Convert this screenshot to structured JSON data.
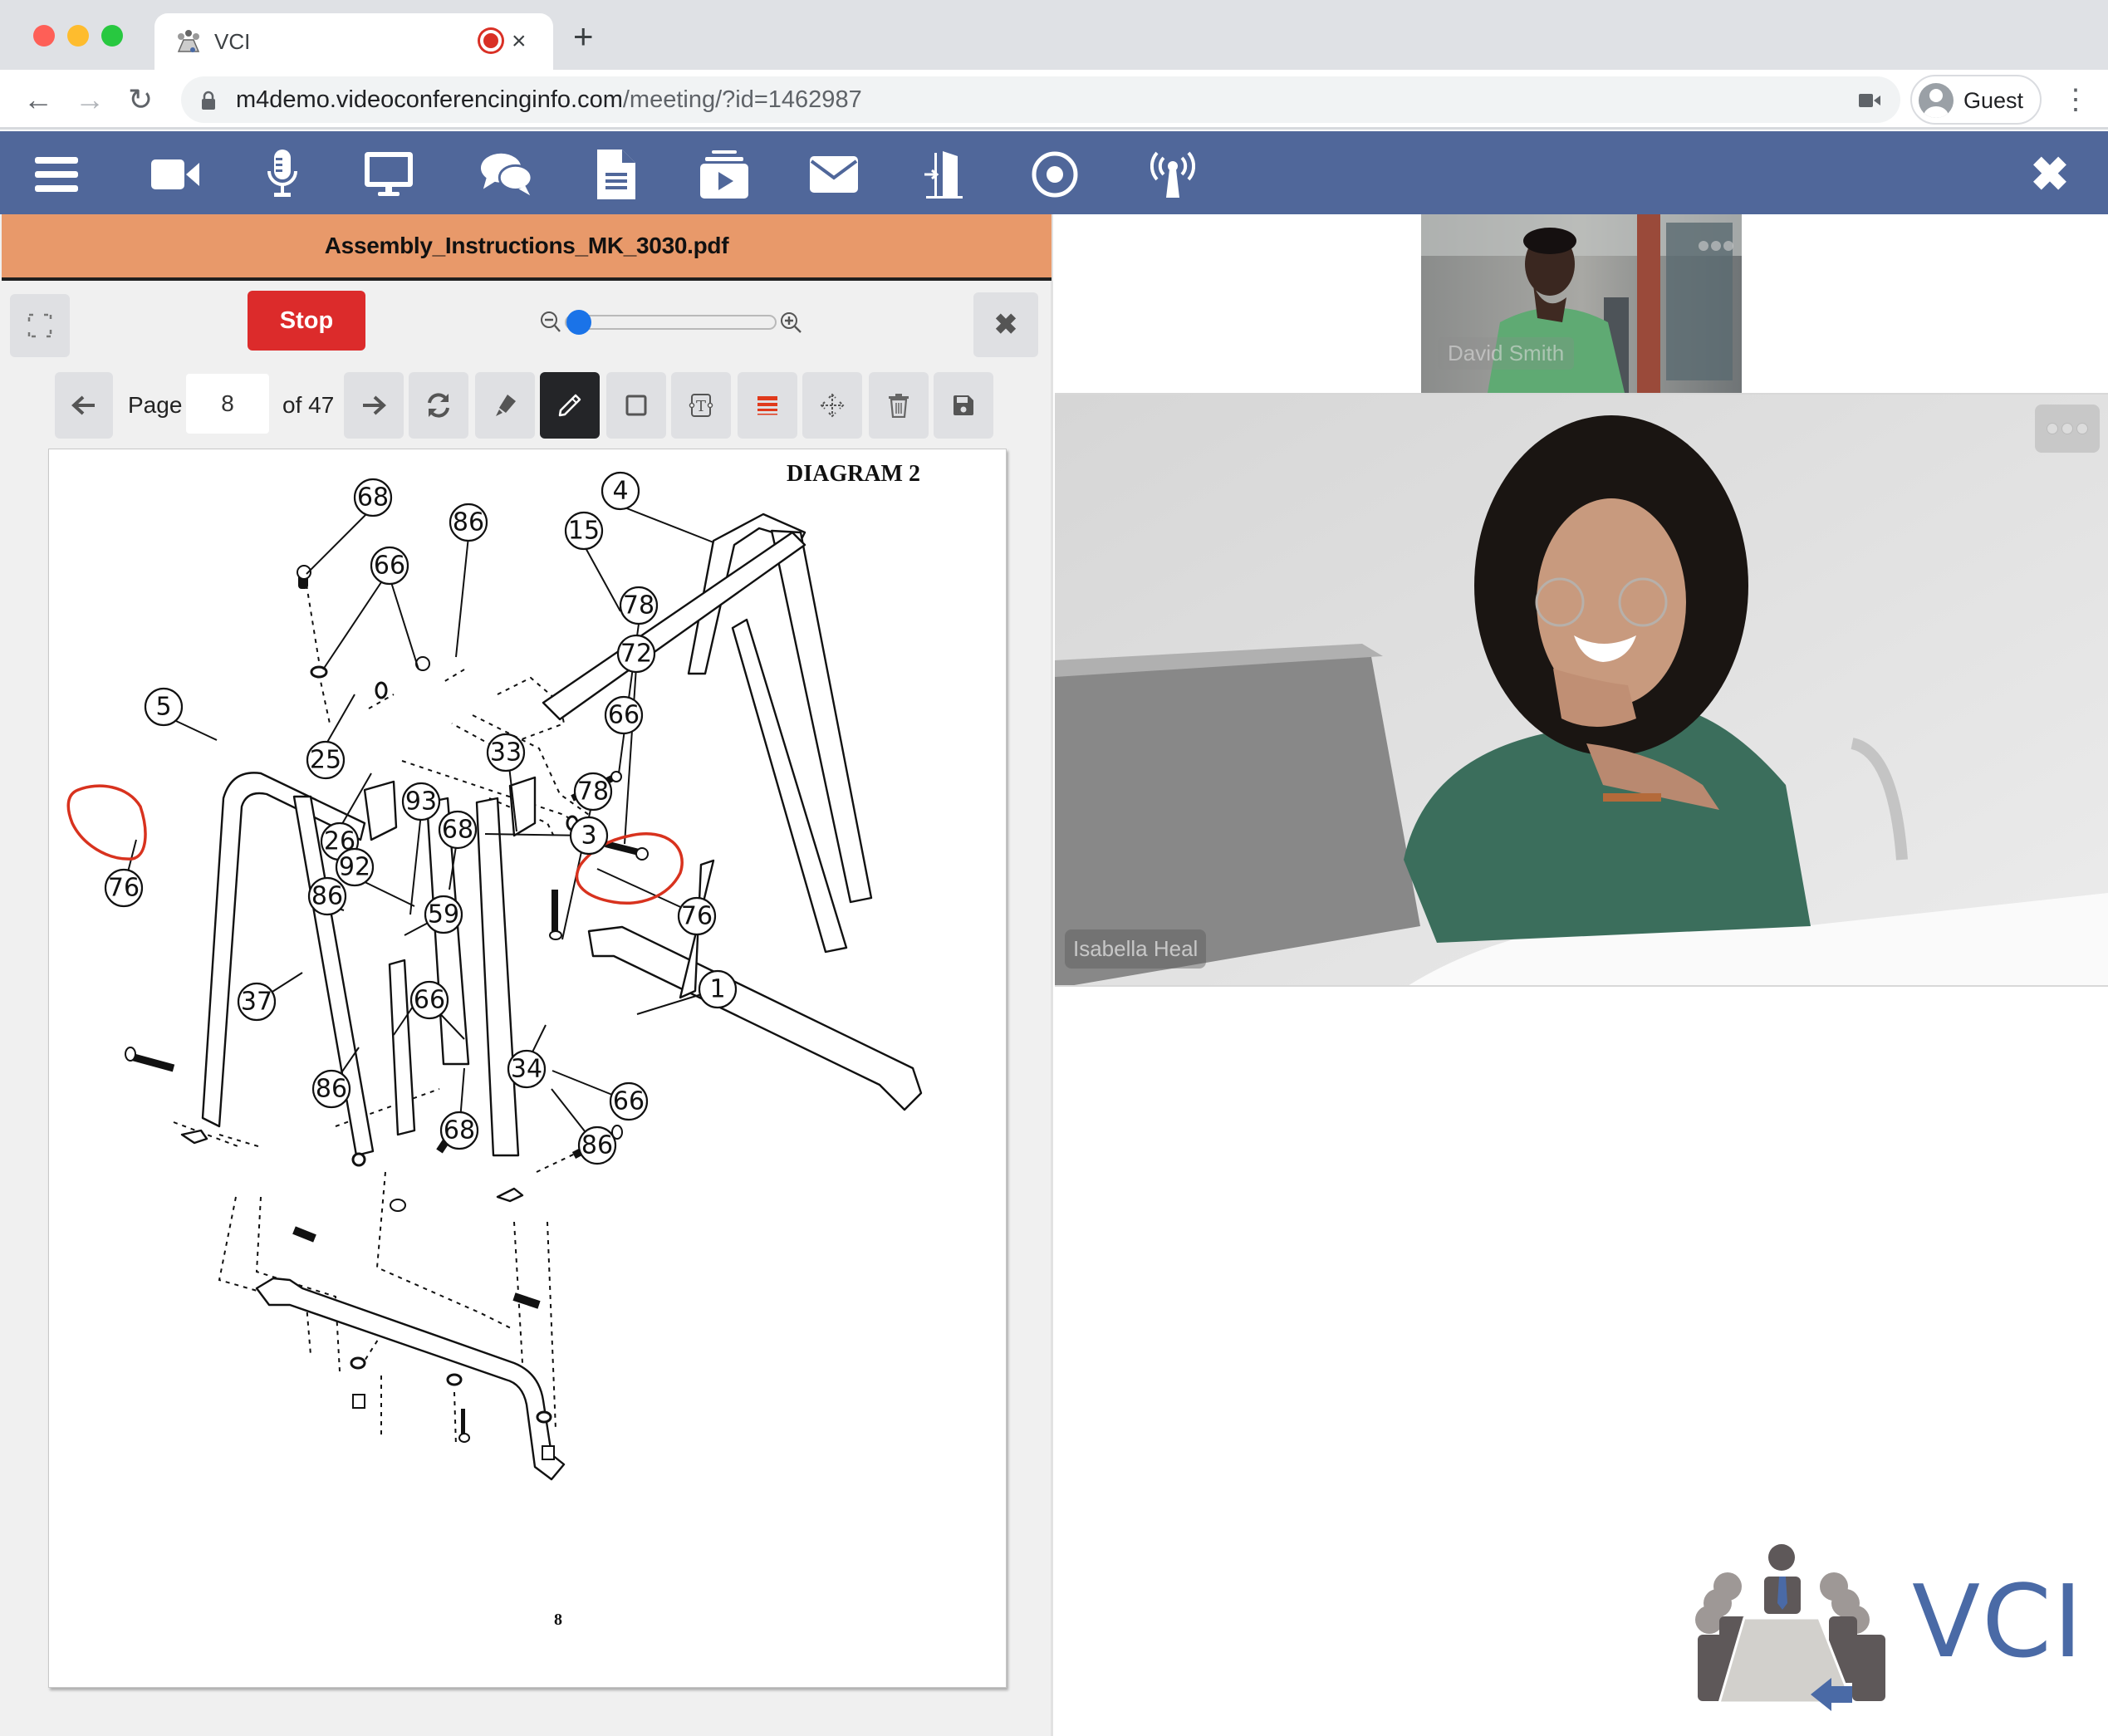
{
  "browser": {
    "tab_title": "VCI",
    "tab_close_glyph": "×",
    "new_tab_glyph": "+",
    "url_domain": "m4demo.videoconferencinginfo.com",
    "url_path": "/meeting/?id=1462987",
    "profile_label": "Guest",
    "back_glyph": "←",
    "forward_glyph": "→",
    "reload_glyph": "↻",
    "menu_glyph": "⋮",
    "recording_indicator_color": "#d93025"
  },
  "app_toolbar": {
    "background": "#50679a",
    "icons": [
      "menu-icon",
      "video-camera-icon",
      "microphone-icon",
      "screen-share-icon",
      "chat-icon",
      "document-icon",
      "media-player-icon",
      "email-icon",
      "exit-door-icon",
      "record-icon",
      "broadcast-icon"
    ],
    "close_glyph": "✖"
  },
  "document": {
    "filename": "Assembly_Instructions_MK_3030.pdf",
    "title_bar_color": "#e8996a",
    "stop_label": "Stop",
    "stop_color": "#dc2b2b",
    "zoom_level_fraction": 0.0,
    "page_label": "Page",
    "current_page": "8",
    "total_pages_label": "of 47",
    "close_glyph": "✖",
    "annotation_tools": [
      "refresh",
      "highlighter",
      "pen",
      "rectangle",
      "text-box",
      "line-width",
      "move",
      "delete",
      "save"
    ],
    "active_tool": "pen",
    "page": {
      "heading": "DIAGRAM 2",
      "page_number": "8",
      "callouts": [
        "68",
        "86",
        "66",
        "4",
        "15",
        "78",
        "72",
        "66",
        "5",
        "25",
        "33",
        "78",
        "26",
        "93",
        "68",
        "3",
        "76",
        "92",
        "86",
        "59",
        "76",
        "37",
        "66",
        "1",
        "34",
        "86",
        "66",
        "68",
        "86"
      ],
      "annotation_color": "#d8321e",
      "circled_parts": [
        "76",
        "76"
      ]
    }
  },
  "participants": [
    {
      "name": "David Smith",
      "tile": "thumbnail"
    },
    {
      "name": "Isabella Heal",
      "tile": "main"
    }
  ],
  "video_menu_glyph": "•••",
  "brand": {
    "logo_text": "VCI",
    "color": "#4a6aa6"
  }
}
